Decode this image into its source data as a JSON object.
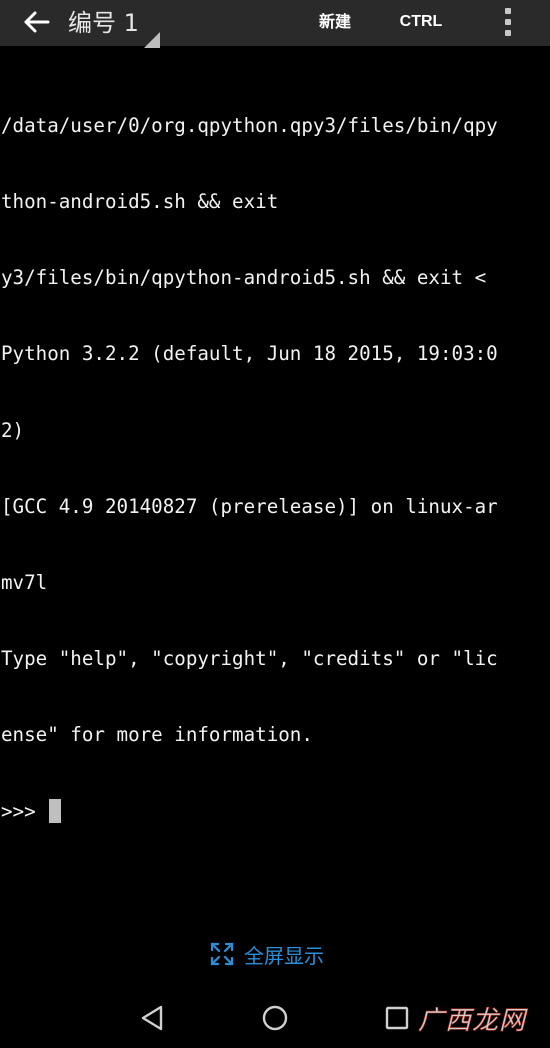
{
  "appbar": {
    "title": "编号 1",
    "new_label": "新建",
    "ctrl_label": "CTRL",
    "back_icon": "arrow-left-icon",
    "overflow_icon": "more-vertical-icon"
  },
  "terminal": {
    "lines": [
      "/data/user/0/org.qpython.qpy3/files/bin/qpy",
      "thon-android5.sh && exit",
      "y3/files/bin/qpython-android5.sh && exit <",
      "Python 3.2.2 (default, Jun 18 2015, 19:03:0",
      "2)",
      "[GCC 4.9 20140827 (prerelease)] on linux-ar",
      "mv7l",
      "Type \"help\", \"copyright\", \"credits\" or \"lic",
      "ense\" for more information."
    ],
    "prompt": ">>> "
  },
  "fullscreen": {
    "label": "全屏显示",
    "icon": "expand-icon"
  },
  "navbar": {
    "back_icon": "nav-back-triangle-icon",
    "home_icon": "nav-home-circle-icon",
    "recent_icon": "nav-recent-square-icon"
  },
  "watermark": {
    "text": "广西龙网"
  },
  "colors": {
    "appbar_bg": "#2a2a2a",
    "terminal_bg": "#000000",
    "terminal_fg": "#f2f2f2",
    "accent": "#2a8fd8"
  }
}
